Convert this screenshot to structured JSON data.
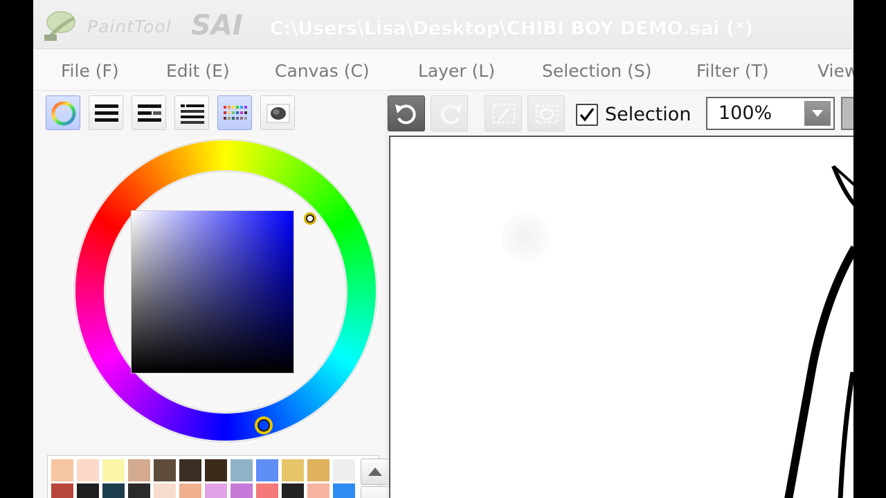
{
  "window": {
    "app_name_small": "PaintTool",
    "app_name_big": "SAI",
    "title_path": "C:\\Users\\Lisa\\Desktop\\CHIBI BOY DEMO.sai (*)"
  },
  "menu": {
    "items": [
      {
        "label": "File (F)"
      },
      {
        "label": "Edit (E)"
      },
      {
        "label": "Canvas (C)"
      },
      {
        "label": "Layer (L)"
      },
      {
        "label": "Selection (S)"
      },
      {
        "label": "Filter (T)"
      },
      {
        "label": "View"
      }
    ]
  },
  "color_toolbar": {
    "buttons": [
      {
        "icon": "color-wheel-icon",
        "active": true
      },
      {
        "icon": "rgb-sliders-icon",
        "active": false
      },
      {
        "icon": "hsv-sliders-icon",
        "active": false
      },
      {
        "icon": "color-mixer-sliders-icon",
        "active": false
      },
      {
        "icon": "swatches-icon",
        "active": true
      },
      {
        "icon": "scratchpad-icon",
        "active": false
      }
    ]
  },
  "color_wheel": {
    "current_hue_color": "#0000ff",
    "current_color": "#0000ff"
  },
  "palette": {
    "row1": [
      "#f6c5a2",
      "#fbd9c6",
      "#fbf5a8",
      "#d3a98f",
      "#5e4b3a",
      "#3b2e22",
      "#3a2a1a",
      "#8fb3c6",
      "#5e8ef6",
      "#e6c46a",
      "#e0b25e",
      "#eeeeee"
    ],
    "row2": [
      "#b8463a",
      "#1f1f1f",
      "#1d3e4e",
      "#2a2a2a",
      "#f8dccd",
      "#f0b08e",
      "#e2a3e6",
      "#c77ad8",
      "#f47a7a",
      "#222222",
      "#f6b3a0",
      "#2e8cf0"
    ]
  },
  "canvas_toolbar": {
    "undo_icon": "undo-icon",
    "redo_icon": "redo-icon",
    "deselect_icon": "deselect-icon",
    "invert_selection_icon": "invert-selection-icon",
    "selection_checked": true,
    "selection_label": "Selection",
    "zoom_value": "100%"
  }
}
